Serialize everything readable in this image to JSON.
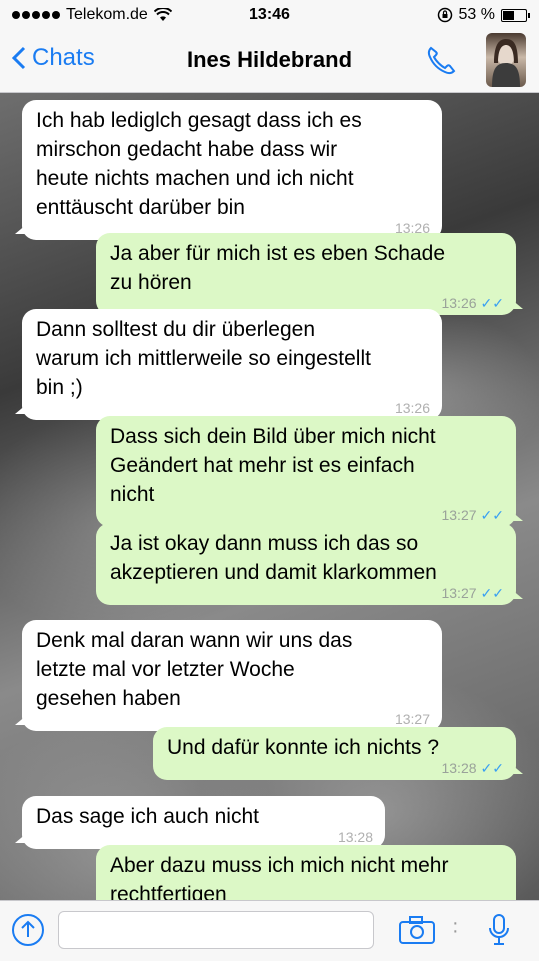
{
  "status": {
    "carrier": "Telekom.de",
    "time": "13:46",
    "battery": "53 %",
    "battery_level": 0.53
  },
  "nav": {
    "back_label": "Chats",
    "title": "Ines Hildebrand"
  },
  "messages": [
    {
      "dir": "in",
      "text": "Ich hab lediglch gesagt dass ich es\nmirschon gedacht habe dass wir\nheute nichts machen und ich nicht\nenttäuscht darüber bin",
      "time": "13:26"
    },
    {
      "dir": "out",
      "text": "Ja aber für mich ist es eben Schade\nzu hören",
      "time": "13:26",
      "ticks": "✓✓"
    },
    {
      "dir": "in",
      "text": "Dann solltest du dir überlegen\nwarum ich mittlerweile so eingestellt\nbin ;)",
      "time": "13:26"
    },
    {
      "dir": "out",
      "text": "Dass sich dein Bild über mich nicht\nGeändert hat mehr ist es einfach\nnicht",
      "time": "13:27",
      "ticks": "✓✓"
    },
    {
      "dir": "out",
      "text": "Ja ist okay dann muss ich das so\nakzeptieren und damit klarkommen",
      "time": "13:27",
      "ticks": "✓✓"
    },
    {
      "dir": "in",
      "text": "Denk mal daran wann wir uns das\nletzte mal vor letzter Woche\ngesehen haben",
      "time": "13:27"
    },
    {
      "dir": "out",
      "text": "Und dafür konnte ich nichts ?",
      "time": "13:28",
      "ticks": "✓✓"
    },
    {
      "dir": "in",
      "text": "Das sage ich auch nicht",
      "time": "13:28"
    },
    {
      "dir": "out",
      "text": "Aber dazu muss ich mich nicht mehr\nrechtfertigen",
      "time": "",
      "ticks": ""
    }
  ],
  "input": {
    "placeholder": ""
  },
  "colors": {
    "accent": "#1a7cf2",
    "outgoing": "#dcf8c6",
    "incoming": "#ffffff"
  }
}
